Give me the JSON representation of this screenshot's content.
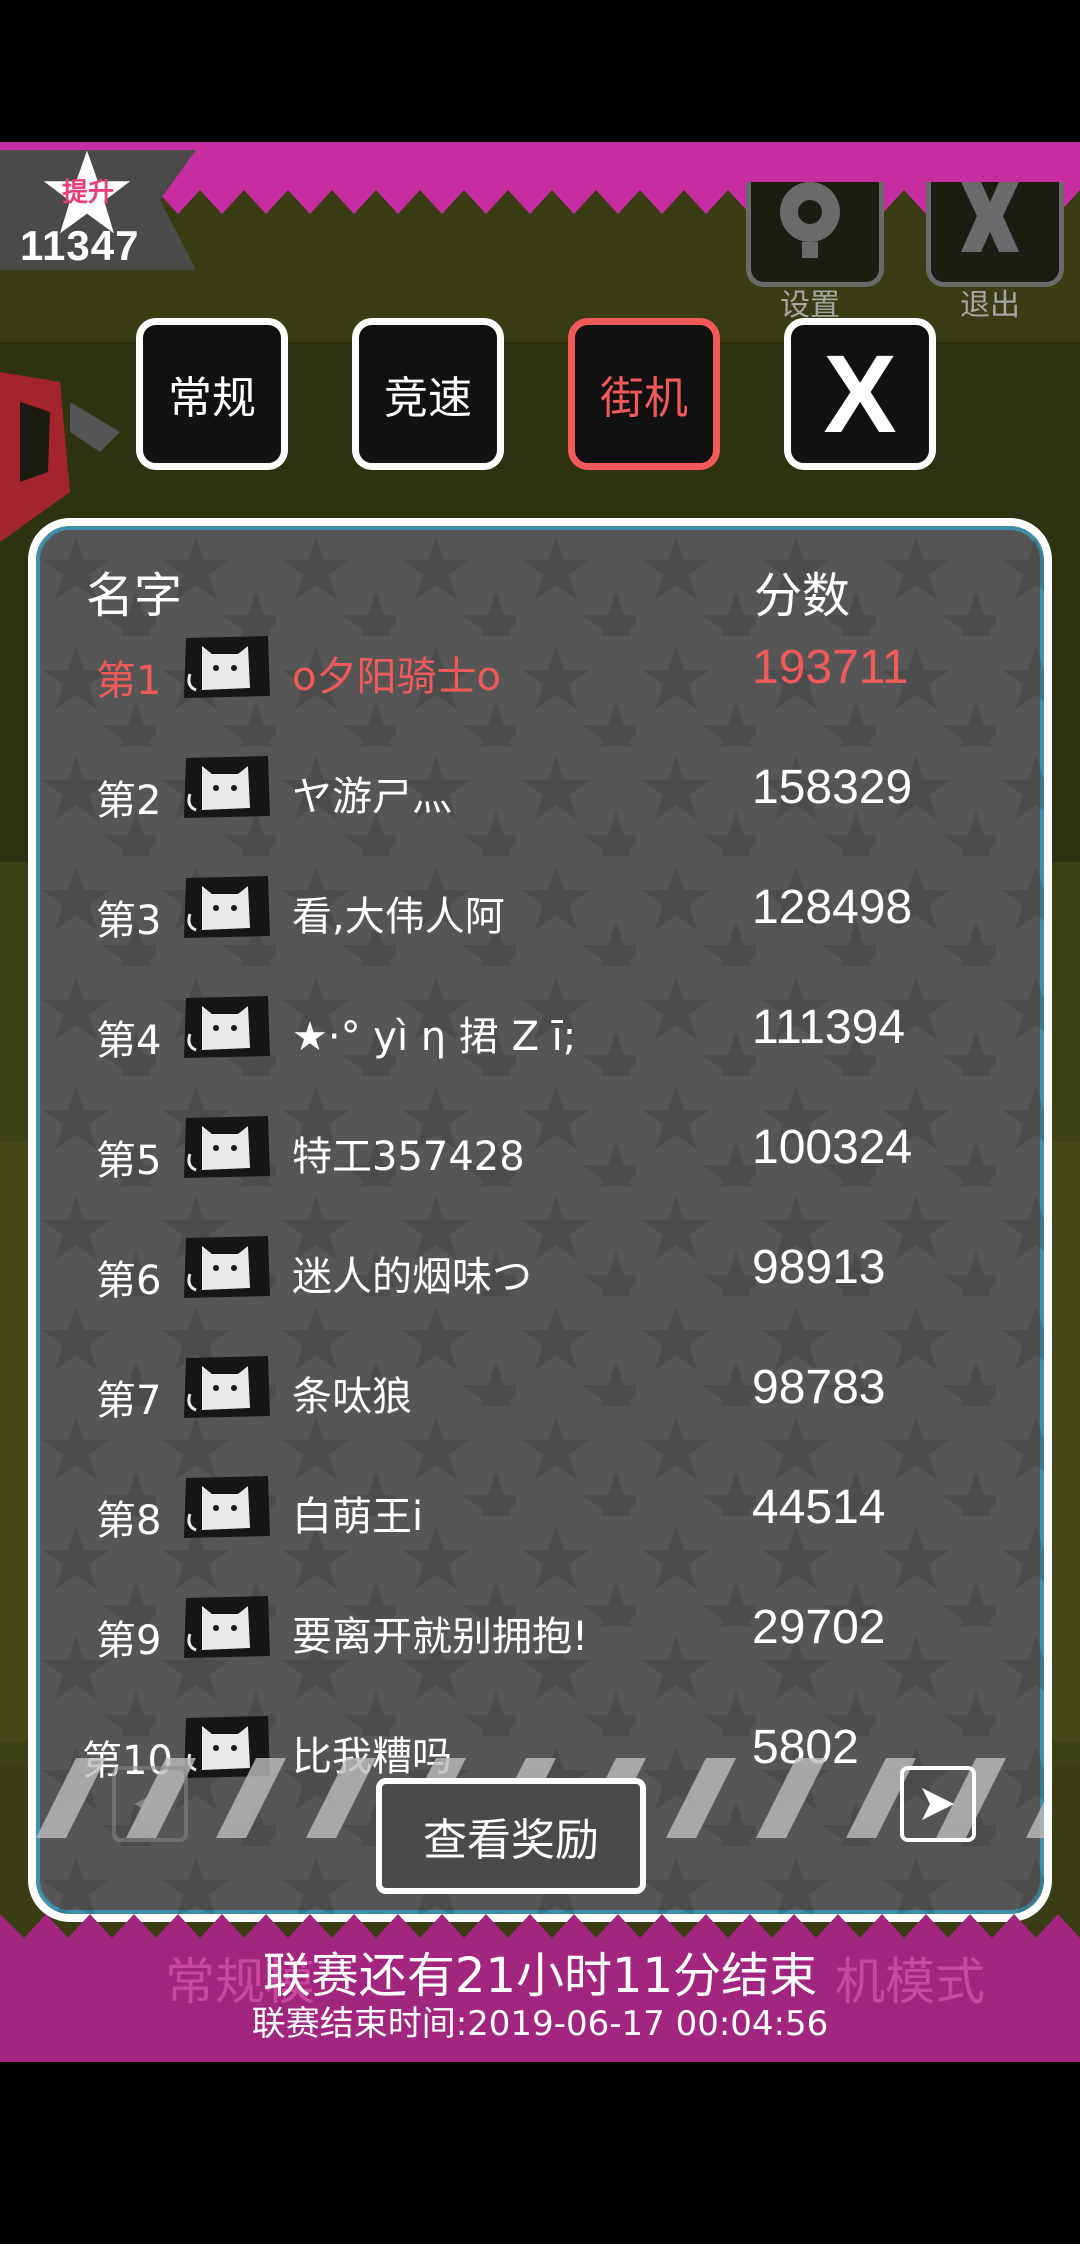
{
  "player": {
    "star_label": "提升",
    "score": "11347"
  },
  "header_buttons": {
    "settings": "设置",
    "exit": "退出"
  },
  "tabs": [
    {
      "label": "常规",
      "active": false
    },
    {
      "label": "竞速",
      "active": false
    },
    {
      "label": "街机",
      "active": true
    },
    {
      "label": "X",
      "active": false
    }
  ],
  "leaderboard": {
    "col_name": "名字",
    "col_score": "分数",
    "rows": [
      {
        "rank": "第1",
        "name": "o夕阳骑士o",
        "score": "193711"
      },
      {
        "rank": "第2",
        "name": "ヤ游ㄕ灬",
        "score": "158329"
      },
      {
        "rank": "第3",
        "name": "看,大伟人阿",
        "score": "128498"
      },
      {
        "rank": "第4",
        "name": "★·° yì η 捃 Ζ ī;",
        "score": "111394"
      },
      {
        "rank": "第5",
        "name": "特工357428",
        "score": "100324"
      },
      {
        "rank": "第6",
        "name": "迷人的烟味つ",
        "score": "98913"
      },
      {
        "rank": "第7",
        "name": "条呔狼",
        "score": "98783"
      },
      {
        "rank": "第8",
        "name": "白萌王i",
        "score": "44514"
      },
      {
        "rank": "第9",
        "name": "要离开就别拥抱!",
        "score": "29702"
      },
      {
        "rank": "第10",
        "name": "比我糟吗",
        "score": "5802"
      }
    ]
  },
  "reward_button": "查看奖励",
  "footer": {
    "ghost_left": "常规模",
    "ghost_right": "机模式",
    "league_remaining": "联赛还有21小时11分结束",
    "league_end_time": "联赛结束时间:2019-06-17 00:04:56"
  },
  "colors": {
    "accent": "#f25a5a",
    "magenta": "#c82ca1",
    "panel": "#565656"
  }
}
